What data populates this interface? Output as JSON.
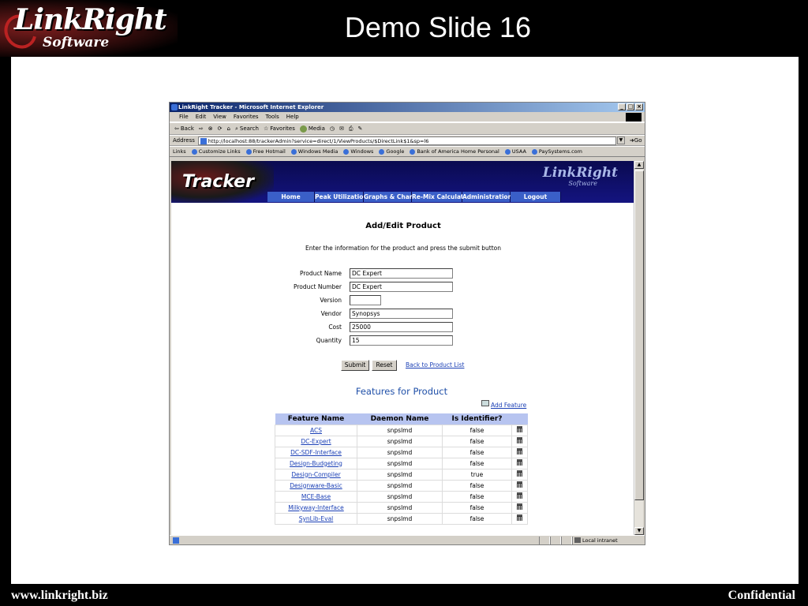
{
  "slide": {
    "logo_main": "LinkRight",
    "logo_sub": "Software",
    "title": "Demo Slide 16",
    "footer_left": "www.linkright.biz",
    "footer_right": "Confidential"
  },
  "browser": {
    "title": "LinkRight Tracker - Microsoft Internet Explorer",
    "menu": [
      "File",
      "Edit",
      "View",
      "Favorites",
      "Tools",
      "Help"
    ],
    "toolbar": [
      "Back",
      "Search",
      "Favorites",
      "Media"
    ],
    "address_label": "Address",
    "address": "http://localhost:88/trackerAdmin?service=direct/1/ViewProducts/$DirectLink$1&sp=l6",
    "go_label": "Go",
    "links_label": "Links",
    "links": [
      "Customize Links",
      "Free Hotmail",
      "Windows Media",
      "Windows",
      "Google",
      "Bank of America Home Personal",
      "USAA",
      "PaySystems.com"
    ],
    "status_zone": "Local intranet"
  },
  "app": {
    "logo": "Tracker",
    "brand": "LinkRight",
    "brand_sub": "Software",
    "nav": [
      "Home",
      "Peak Utilization",
      "Graphs & Charts",
      "Re-Mix Calculator",
      "Administration",
      "Logout"
    ],
    "form_title": "Add/Edit Product",
    "instructions": "Enter the information for the product and press the submit button",
    "fields": [
      {
        "label": "Product Name",
        "value": "DC Expert"
      },
      {
        "label": "Product Number",
        "value": "DC Expert"
      },
      {
        "label": "Version",
        "value": ""
      },
      {
        "label": "Vendor",
        "value": "Synopsys"
      },
      {
        "label": "Cost",
        "value": "25000"
      },
      {
        "label": "Quantity",
        "value": "15"
      }
    ],
    "submit_label": "Submit",
    "reset_label": "Reset",
    "back_link": "Back to Product List",
    "features_title": "Features for Product",
    "add_feature": "Add Feature",
    "table_headers": [
      "Feature Name",
      "Daemon Name",
      "Is Identifier?"
    ],
    "rows": [
      {
        "name": "ACS",
        "daemon": "snpslmd",
        "identifier": "false"
      },
      {
        "name": "DC-Expert",
        "daemon": "snpslmd",
        "identifier": "false"
      },
      {
        "name": "DC-SDF-Interface",
        "daemon": "snpslmd",
        "identifier": "false"
      },
      {
        "name": "Design-Budgeting",
        "daemon": "snpslmd",
        "identifier": "false"
      },
      {
        "name": "Design-Compiler",
        "daemon": "snpslmd",
        "identifier": "true"
      },
      {
        "name": "Designware-Basic",
        "daemon": "snpslmd",
        "identifier": "false"
      },
      {
        "name": "MCE-Base",
        "daemon": "snpslmd",
        "identifier": "false"
      },
      {
        "name": "Milkyway-Interface",
        "daemon": "snpslmd",
        "identifier": "false"
      },
      {
        "name": "SynLib-Eval",
        "daemon": "snpslmd",
        "identifier": "false"
      }
    ]
  }
}
